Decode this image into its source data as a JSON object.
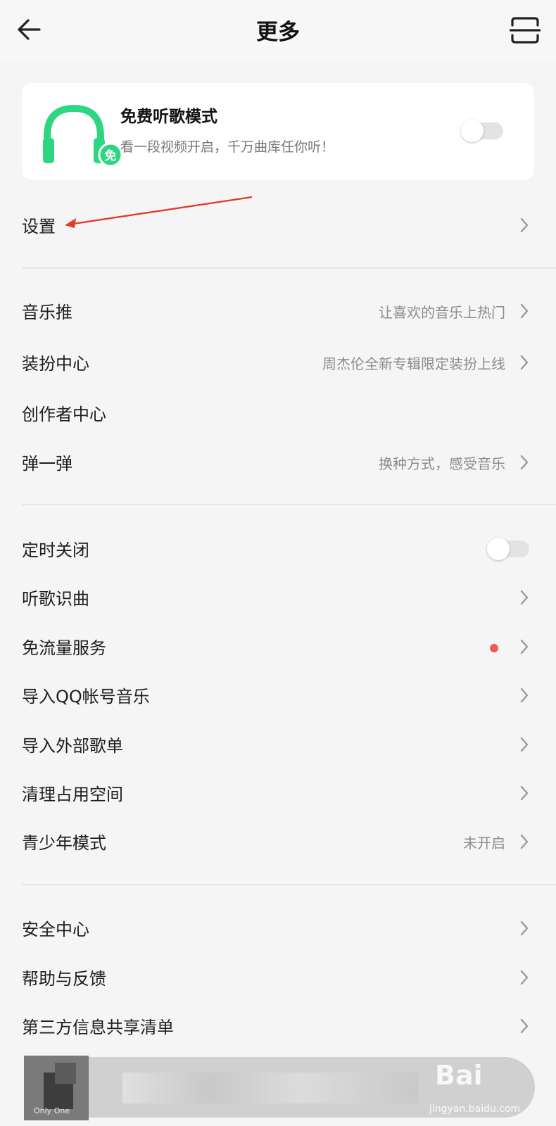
{
  "header": {
    "title": "更多",
    "back_icon": "arrow-left-icon",
    "scan_icon": "scan-icon"
  },
  "promo": {
    "title": "免费听歌模式",
    "subtitle": "看一段视频开启，千万曲库任你听！",
    "badge": "免",
    "accent": "#2fd681",
    "enabled": false
  },
  "sections": [
    {
      "rows": [
        {
          "label": "设置",
          "chevron": true
        }
      ]
    },
    {
      "rows": [
        {
          "label": "音乐推",
          "hint": "让喜欢的音乐上热门",
          "chevron": true
        },
        {
          "label": "装扮中心",
          "hint": "周杰伦全新专辑限定装扮上线",
          "chevron": true
        },
        {
          "label": "创作者中心",
          "chevron": false
        },
        {
          "label": "弹一弹",
          "hint": "换种方式，感受音乐",
          "chevron": true
        }
      ]
    },
    {
      "rows": [
        {
          "label": "定时关闭",
          "toggle": false
        },
        {
          "label": "听歌识曲",
          "chevron": true
        },
        {
          "label": "免流量服务",
          "dot": true,
          "dot_color": "#ec5a5a",
          "chevron": true
        },
        {
          "label": "导入QQ帐号音乐",
          "chevron": true
        },
        {
          "label": "导入外部歌单",
          "chevron": true
        },
        {
          "label": "清理占用空间",
          "chevron": true
        },
        {
          "label": "青少年模式",
          "hint": "未开启",
          "chevron": true
        }
      ]
    },
    {
      "rows": [
        {
          "label": "安全中心",
          "chevron": true
        },
        {
          "label": "帮助与反馈",
          "chevron": true
        },
        {
          "label": "第三方信息共享清单",
          "chevron": true
        }
      ]
    }
  ],
  "mini_player": {
    "cover_text": "Only One"
  },
  "watermark": {
    "brand": "Bai",
    "domain": "jingyan.baidu.com"
  }
}
